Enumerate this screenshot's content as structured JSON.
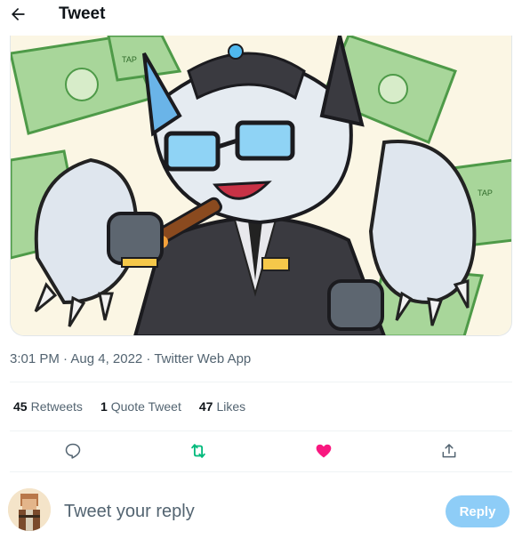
{
  "header": {
    "title": "Tweet"
  },
  "media": {
    "alt": "Cartoon character illustration with money background",
    "money_label": "TAP"
  },
  "tweet": {
    "timestamp": "3:01 PM · Aug 4, 2022 · Twitter Web App"
  },
  "stats": {
    "retweets_count": "45",
    "retweets_label": "Retweets",
    "quotes_count": "1",
    "quotes_label": "Quote Tweet",
    "likes_count": "47",
    "likes_label": "Likes"
  },
  "actions": {
    "reply_icon": "comment-icon",
    "retweet_icon": "retweet-icon",
    "retweet_color": "#00ba7c",
    "like_icon": "heart-icon",
    "like_color": "#f91880",
    "share_icon": "share-icon"
  },
  "reply": {
    "placeholder": "Tweet your reply",
    "button_label": "Reply",
    "button_color": "#8ecdf7"
  }
}
